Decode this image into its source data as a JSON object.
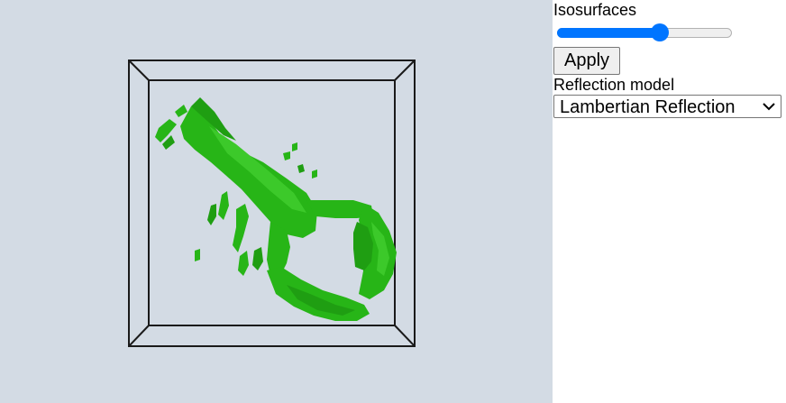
{
  "controls": {
    "isosurfaces_label": "Isosurfaces",
    "isosurfaces_level": 0.59,
    "apply_label": "Apply",
    "reflection_label": "Reflection model",
    "reflection_selected": "Lambertian Reflection"
  },
  "colors": {
    "viewport_background": "#d3dbe4",
    "isosurface": "#22b414",
    "slider_accent": "#0075ff",
    "box_outline": "#1a1a1a"
  }
}
